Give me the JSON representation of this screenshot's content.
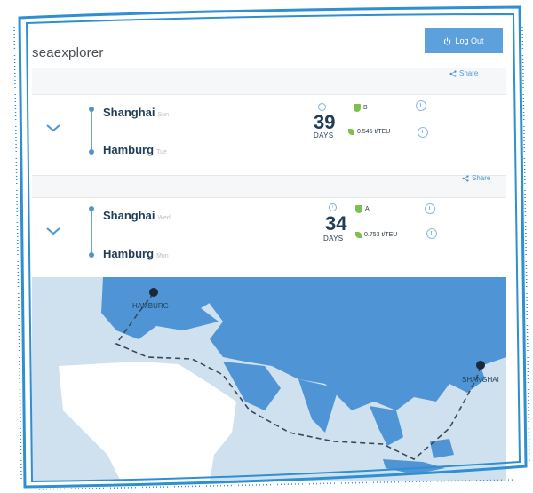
{
  "app": {
    "name": "seaexplorer"
  },
  "header": {
    "logout_label": "Log Out"
  },
  "share_label": "Share",
  "routes": [
    {
      "origin": "Shanghai",
      "origin_day": "Sun",
      "destination": "Hamburg",
      "destination_day": "Tue",
      "days": "39",
      "days_label": "DAYS",
      "grade": "B",
      "co2": "0.545 t/TEU"
    },
    {
      "origin": "Shanghai",
      "origin_day": "Wed",
      "destination": "Hamburg",
      "destination_day": "Mon",
      "days": "34",
      "days_label": "DAYS",
      "grade": "A",
      "co2": "0.753 t/TEU"
    }
  ],
  "map": {
    "labels": [
      "HAMBURG",
      "SHANGHAI"
    ]
  },
  "colors": {
    "accent": "#5ca0dc",
    "sea": "#cfe1ef",
    "land": "#4f95d6",
    "eco": "#7cc14f"
  }
}
